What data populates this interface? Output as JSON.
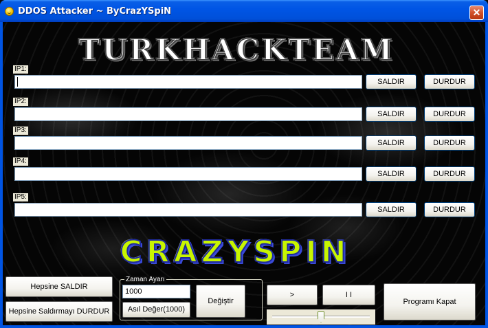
{
  "window": {
    "title": "DDOS Attacker ~ ByCrazYSpiN",
    "close_symbol": "✕",
    "icon": "smiley-icon"
  },
  "banner": {
    "text": "TURKHACKTEAM"
  },
  "targets": [
    {
      "label": "IP1:",
      "value": "",
      "attack_label": "SALDIR",
      "stop_label": "DURDUR"
    },
    {
      "label": "IP2:",
      "value": "",
      "attack_label": "SALDIR",
      "stop_label": "DURDUR"
    },
    {
      "label": "IP3:",
      "value": "",
      "attack_label": "SALDIR",
      "stop_label": "DURDUR"
    },
    {
      "label": "IP4:",
      "value": "",
      "attack_label": "SALDIR",
      "stop_label": "DURDUR"
    },
    {
      "label": "IP5:",
      "value": "",
      "attack_label": "SALDIR",
      "stop_label": "DURDUR"
    }
  ],
  "logo": {
    "text": "CRAZYSPIN",
    "fill_color": "#c8f500",
    "stroke_color": "#1e2a9a"
  },
  "controls": {
    "attack_all_label": "Hepsine SALDIR",
    "stop_all_label": "Hepsine Saldırmayı DURDUR",
    "play_label": ">",
    "pause_label": "I I",
    "close_program_label": "Programı Kapat"
  },
  "timer": {
    "legend": "Zaman Ayarı",
    "value": "1000",
    "reset_label": "Asıl Değer(1000)",
    "change_label": "Değiştir"
  },
  "slider": {
    "value_fraction": 0.5
  },
  "colors": {
    "titlebar": "#0055e5",
    "button_border": "#003c74",
    "background": "#050505"
  }
}
